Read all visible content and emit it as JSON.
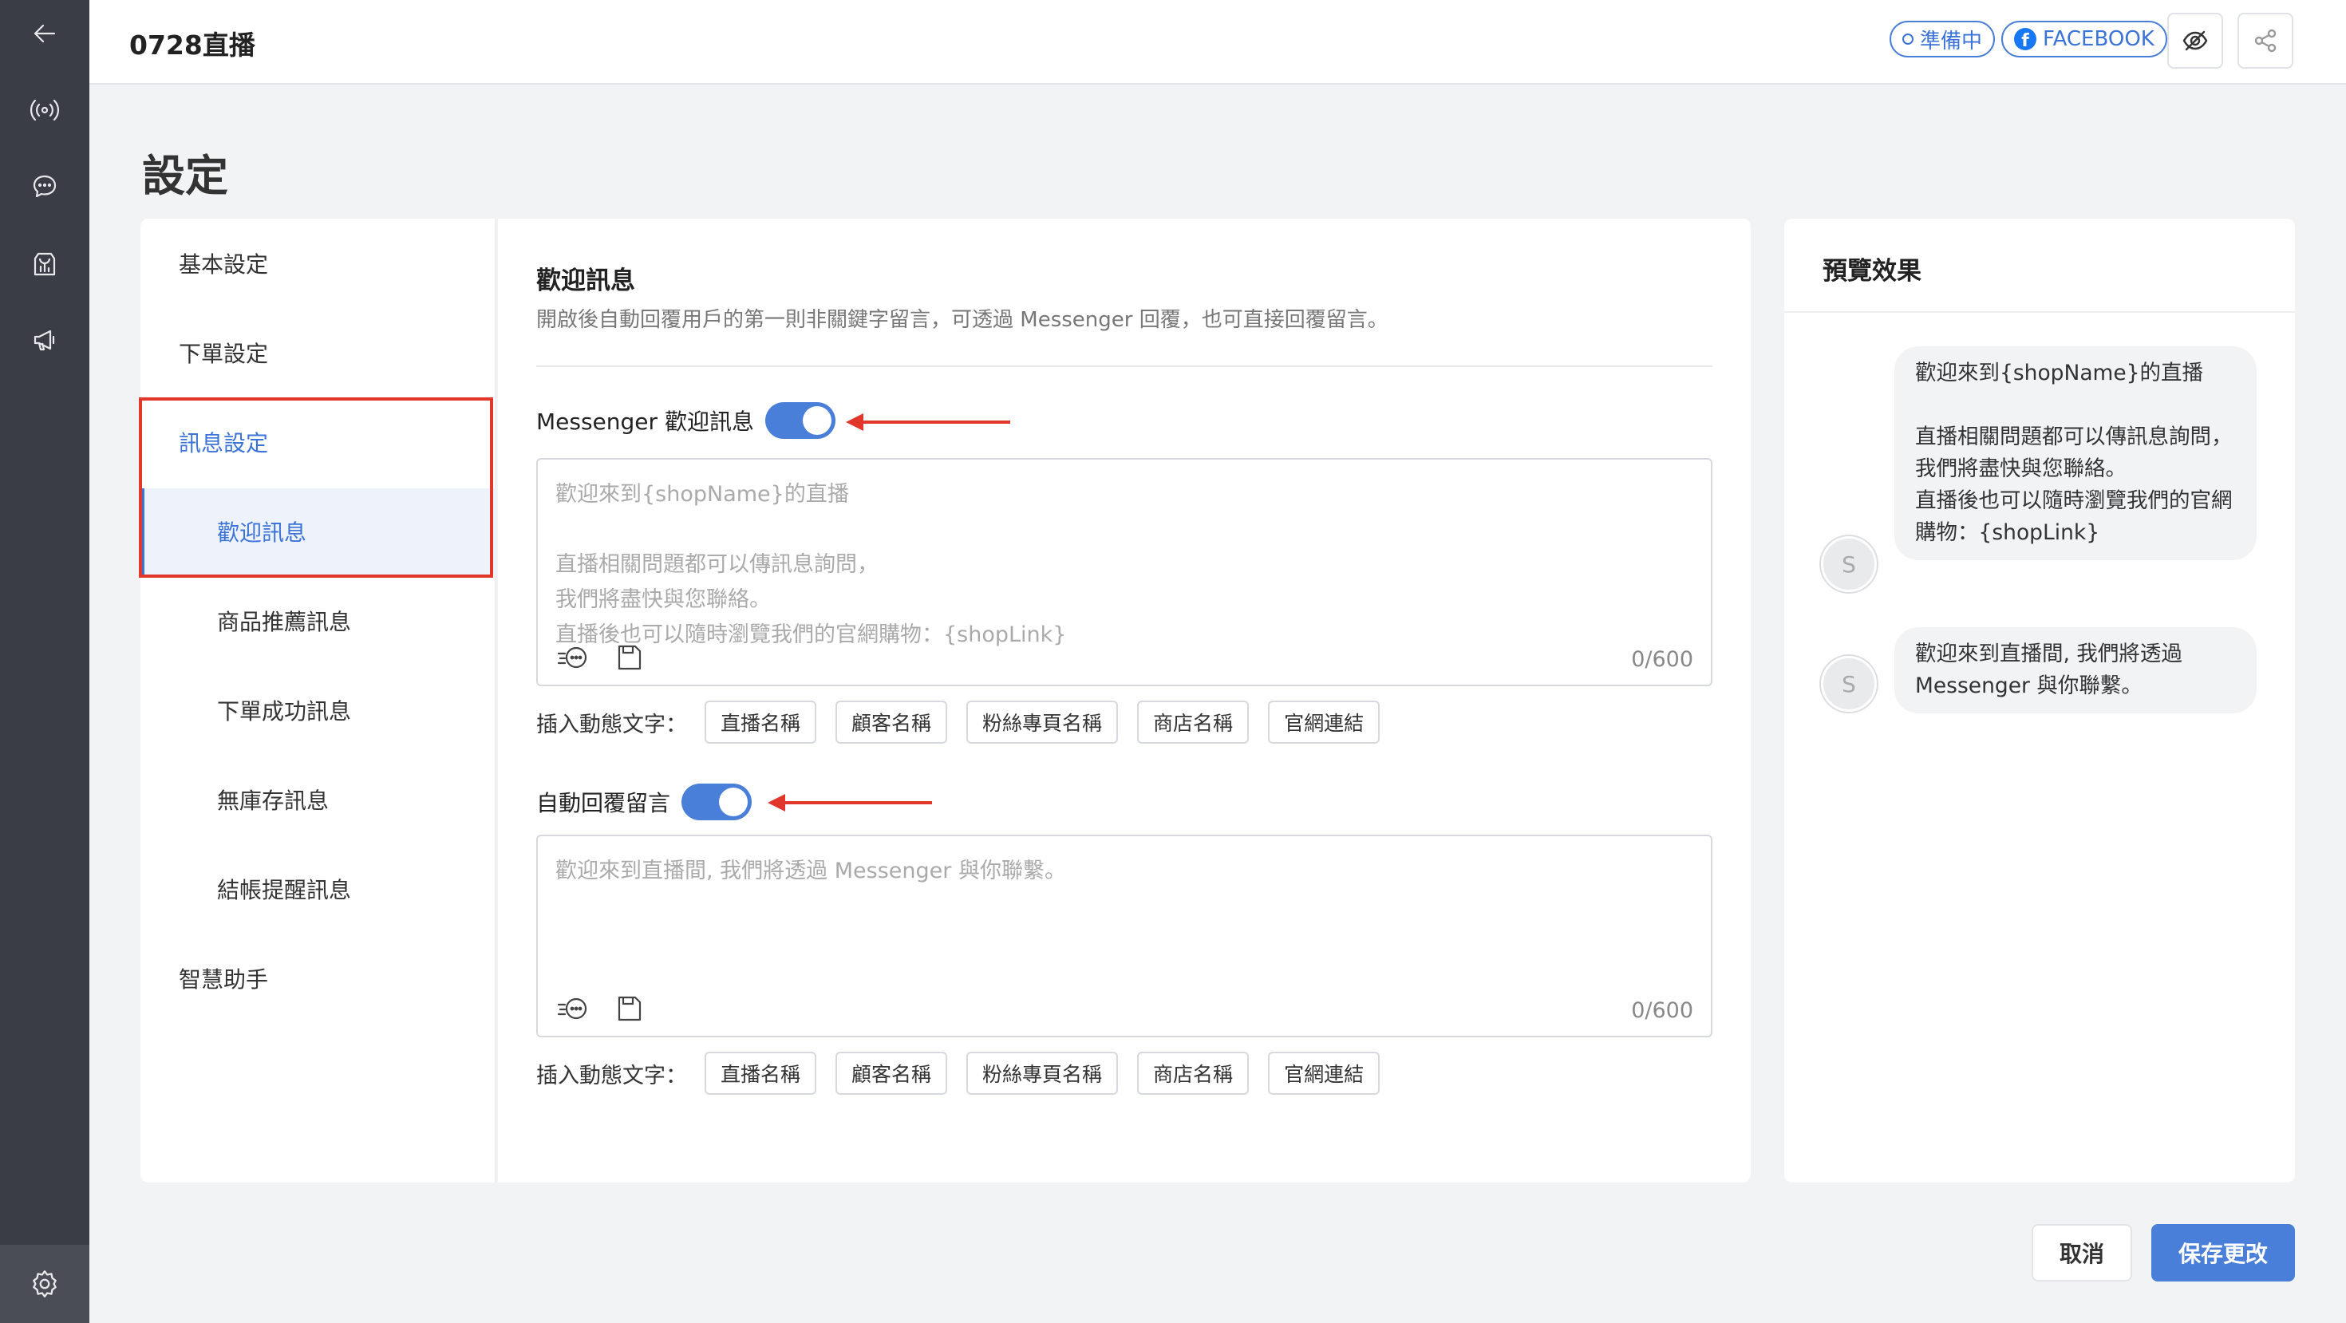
{
  "header": {
    "title": "0728直播",
    "status_pill": "準備中",
    "platform_pill": "FACEBOOK",
    "fb_letter": "f"
  },
  "page_title": "設定",
  "nav": {
    "items": [
      {
        "label": "基本設定"
      },
      {
        "label": "下單設定"
      },
      {
        "label": "訊息設定"
      },
      {
        "label": "歡迎訊息"
      },
      {
        "label": "商品推薦訊息"
      },
      {
        "label": "下單成功訊息"
      },
      {
        "label": "無庫存訊息"
      },
      {
        "label": "結帳提醒訊息"
      },
      {
        "label": "智慧助手"
      }
    ]
  },
  "section": {
    "title": "歡迎訊息",
    "description": "開啟後自動回覆用戶的第一則非關鍵字留言，可透過 Messenger 回覆，也可直接回覆留言。"
  },
  "messenger": {
    "label": "Messenger 歡迎訊息",
    "enabled": true,
    "placeholder": "歡迎來到{shopName}的直播\n\n直播相關問題都可以傳訊息詢問，\n我們將盡快與您聯絡。\n直播後也可以隨時瀏覽我們的官網購物：{shopLink}",
    "counter": "0/600"
  },
  "auto_reply": {
    "label": "自動回覆留言",
    "enabled": true,
    "placeholder": "歡迎來到直播間, 我們將透過 Messenger 與你聯繫。",
    "counter": "0/600"
  },
  "insert": {
    "label": "插入動態文字：",
    "tags": [
      "直播名稱",
      "顧客名稱",
      "粉絲專頁名稱",
      "商店名稱",
      "官網連結"
    ]
  },
  "preview": {
    "title": "預覽效果",
    "avatar_letter": "S",
    "bubble1": [
      "歡迎來到{shopName}的直播",
      " ",
      "直播相關問題都可以傳訊息詢問，",
      "我們將盡快與您聯絡。",
      "直播後也可以隨時瀏覽我們的官網購物：{shopLink}"
    ],
    "bubble2": "歡迎來到直播間, 我們將透過 Messenger 與你聯繫。"
  },
  "buttons": {
    "cancel": "取消",
    "save": "保存更改"
  },
  "colors": {
    "accent": "#4a7fd9",
    "highlight_box": "#e2372b",
    "rail": "#3a3d45"
  }
}
